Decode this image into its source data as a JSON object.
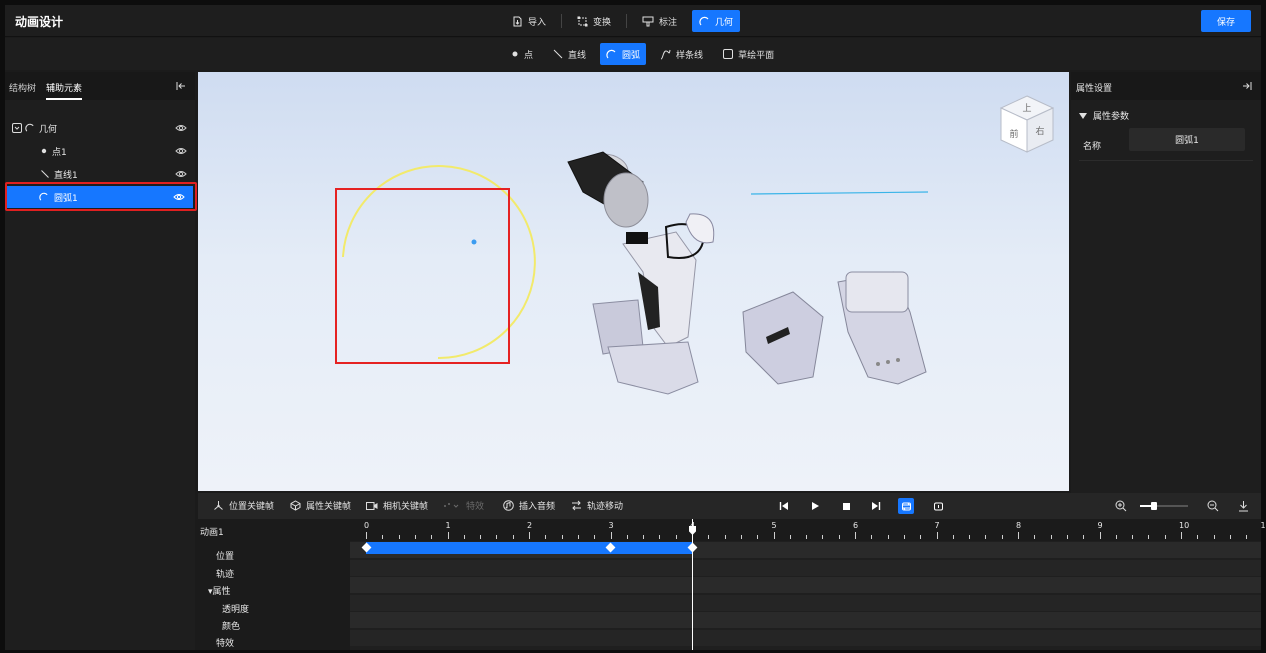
{
  "app": {
    "title": "动画设计",
    "save_label": "保存"
  },
  "top_tools": [
    {
      "label": "导入",
      "icon": "import-icon"
    },
    {
      "label": "变换",
      "icon": "transform-icon"
    },
    {
      "label": "标注",
      "icon": "annotate-icon"
    },
    {
      "label": "几何",
      "icon": "arc-icon",
      "active": true
    }
  ],
  "geometry_tools": [
    {
      "label": "点",
      "icon": "point-icon"
    },
    {
      "label": "直线",
      "icon": "line-icon"
    },
    {
      "label": "圆弧",
      "icon": "arc-icon",
      "active": true
    },
    {
      "label": "样条线",
      "icon": "spline-icon"
    },
    {
      "label": "草绘平面",
      "icon": "sketch-plane-icon"
    }
  ],
  "left_panel": {
    "tabs": [
      "结构树",
      "辅助元素"
    ],
    "active_tab": "辅助元素",
    "tree": [
      {
        "label": "几何",
        "level": 0
      },
      {
        "label": "点1",
        "level": 1
      },
      {
        "label": "直线1",
        "level": 1
      },
      {
        "label": "圆弧1",
        "level": 1,
        "selected": true
      }
    ]
  },
  "viewcube": {
    "top": "上",
    "front": "前",
    "right": "右"
  },
  "right_panel": {
    "title": "属性设置",
    "section": "属性参数",
    "name_label": "名称",
    "name_value": "圆弧1"
  },
  "timeline": {
    "tools": [
      {
        "label": "位置关键帧",
        "icon": "position-keyframe-icon"
      },
      {
        "label": "属性关键帧",
        "icon": "property-keyframe-icon"
      },
      {
        "label": "相机关键帧",
        "icon": "camera-keyframe-icon"
      },
      {
        "label": "特效",
        "icon": "effect-icon",
        "disabled": true
      },
      {
        "label": "插入音频",
        "icon": "audio-icon"
      },
      {
        "label": "轨迹移动",
        "icon": "track-move-icon"
      }
    ],
    "animation_name": "动画1",
    "tracks": {
      "position": "位置",
      "trajectory": "轨迹",
      "attributes": "▾属性",
      "opacity": "透明度",
      "color": "颜色",
      "effect": "特效"
    },
    "ruler_labels": [
      "0",
      "1",
      "2",
      "3",
      "4",
      "5",
      "6",
      "7",
      "8",
      "9",
      "10",
      "1"
    ],
    "playhead_time": 4,
    "position_keyframes": [
      0,
      3,
      4
    ]
  },
  "colors": {
    "accent": "#1677ff",
    "highlight": "#e52222",
    "arc": "#f2ea6b"
  }
}
